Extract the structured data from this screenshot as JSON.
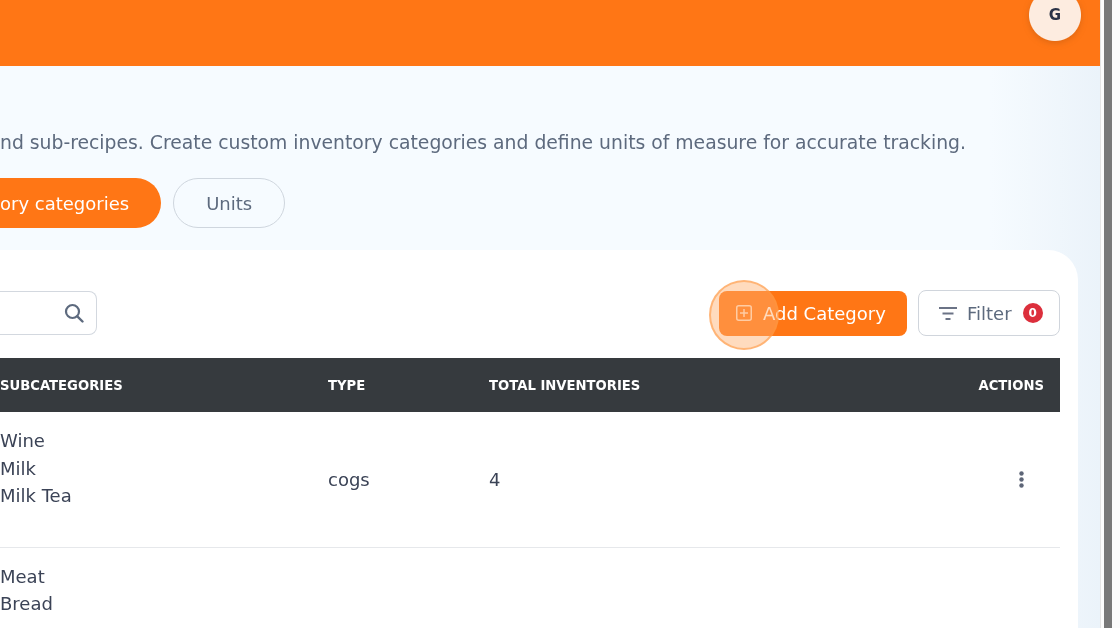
{
  "header": {
    "avatar": "G"
  },
  "description": "nd sub-recipes. Create custom inventory categories and define units of measure for accurate tracking.",
  "tabs": [
    {
      "label": "ory categories",
      "selected": true
    },
    {
      "label": "Units",
      "selected": false
    }
  ],
  "toolbar": {
    "add_button": "Add Category",
    "filter": {
      "label": "Filter",
      "count": "0"
    }
  },
  "table": {
    "columns": [
      "SUBCATEGORIES",
      "TYPE",
      "TOTAL INVENTORIES",
      "ACTIONS"
    ],
    "rows": [
      {
        "subcategories": [
          "Wine",
          "Milk",
          "Milk Tea"
        ],
        "type": "cogs",
        "total_inventories": "4",
        "menu": true
      },
      {
        "subcategories": [
          "Meat",
          "Bread"
        ]
      }
    ]
  }
}
